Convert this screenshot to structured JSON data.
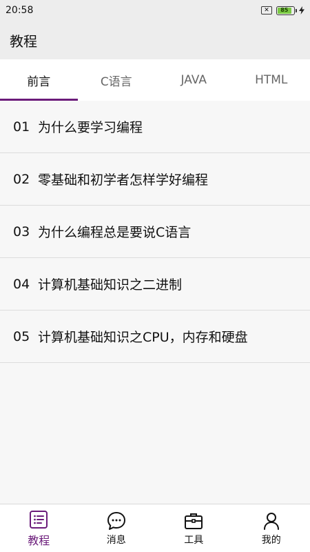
{
  "status": {
    "time": "20:58",
    "battery_level": "85",
    "battery_percent": 85
  },
  "header": {
    "title": "教程"
  },
  "tabs": [
    {
      "label": "前言",
      "active": true
    },
    {
      "label": "C语言",
      "active": false
    },
    {
      "label": "JAVA",
      "active": false
    },
    {
      "label": "HTML",
      "active": false
    }
  ],
  "lessons": [
    {
      "num": "01",
      "title": "为什么要学习编程"
    },
    {
      "num": "02",
      "title": "零基础和初学者怎样学好编程"
    },
    {
      "num": "03",
      "title": "为什么编程总是要说C语言"
    },
    {
      "num": "04",
      "title": "计算机基础知识之二进制"
    },
    {
      "num": "05",
      "title": "计算机基础知识之CPU，内存和硬盘"
    }
  ],
  "bottom_nav": [
    {
      "label": "教程",
      "icon": "tutorial-list-icon",
      "active": true
    },
    {
      "label": "消息",
      "icon": "message-bubble-icon",
      "active": false
    },
    {
      "label": "工具",
      "icon": "toolbox-icon",
      "active": false
    },
    {
      "label": "我的",
      "icon": "person-icon",
      "active": false
    }
  ],
  "colors": {
    "accent": "#6b1b7a",
    "battery": "#7ac943",
    "background": "#f7f7f7",
    "header": "#ededed"
  }
}
